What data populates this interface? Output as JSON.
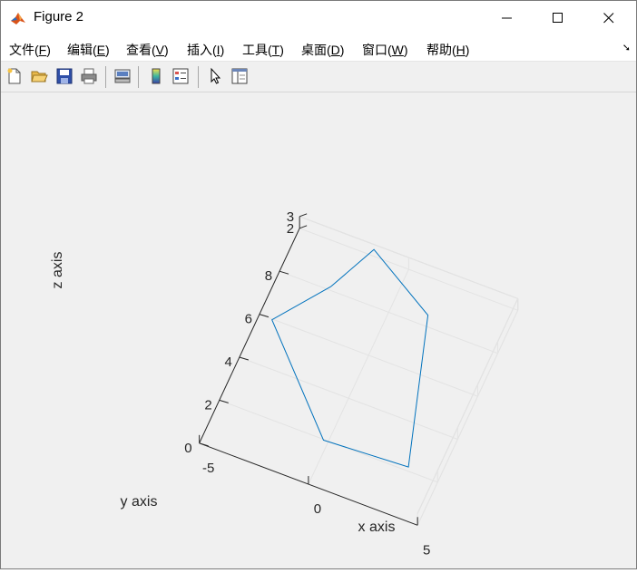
{
  "window": {
    "title": "Figure 2",
    "controls": {
      "minimize": "—",
      "maximize": "☐",
      "close": "✕"
    }
  },
  "menubar": {
    "items": [
      {
        "label": "文件(",
        "mn": "F",
        "end": ")"
      },
      {
        "label": "编辑(",
        "mn": "E",
        "end": ")"
      },
      {
        "label": "查看(",
        "mn": "V",
        "end": ")"
      },
      {
        "label": "插入(",
        "mn": "I",
        "end": ")"
      },
      {
        "label": "工具(",
        "mn": "T",
        "end": ")"
      },
      {
        "label": "桌面(",
        "mn": "D",
        "end": ")"
      },
      {
        "label": "窗口(",
        "mn": "W",
        "end": ")"
      },
      {
        "label": "帮助(",
        "mn": "H",
        "end": ")"
      }
    ]
  },
  "toolbar": {
    "icons": [
      "new-figure-icon",
      "open-file-icon",
      "save-icon",
      "print-icon",
      "link-plot-icon",
      "insert-colorbar-icon",
      "insert-legend-icon",
      "edit-plot-icon",
      "property-inspector-icon"
    ]
  },
  "chart_data": {
    "type": "line",
    "view": "3d",
    "series": [
      {
        "x": [
          -2.5,
          -4.2,
          0,
          3.8,
          1.8,
          -1.5,
          -2.5
        ],
        "y": [
          7.7,
          5.5,
          1.5,
          1.7,
          8.0,
          9.8,
          7.7
        ],
        "z": [
          3,
          3,
          3,
          3,
          3,
          3,
          3
        ],
        "color": "#0072bd"
      }
    ],
    "xlabel": "x axis",
    "ylabel": "y axis",
    "zlabel": "z axis",
    "x_ticks": [
      "-5",
      "0",
      "5"
    ],
    "y_ticks": [
      "0",
      "2",
      "4",
      "6",
      "8"
    ],
    "z_ticks": [
      "2",
      "3"
    ],
    "xlim": [
      -5,
      5
    ],
    "ylim": [
      0,
      10
    ],
    "zlim": [
      2,
      3
    ],
    "grid": true
  }
}
